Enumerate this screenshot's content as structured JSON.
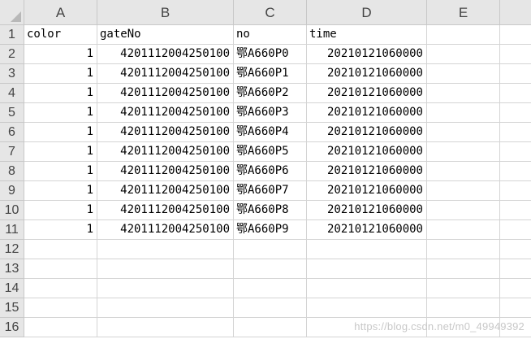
{
  "columns": [
    "A",
    "B",
    "C",
    "D",
    "E"
  ],
  "row_numbers": [
    "1",
    "2",
    "3",
    "4",
    "5",
    "6",
    "7",
    "8",
    "9",
    "10",
    "11",
    "12",
    "13",
    "14",
    "15",
    "16"
  ],
  "header": {
    "color": "color",
    "gateNo": "gateNo",
    "no": "no",
    "time": "time"
  },
  "rows": [
    {
      "color": "1",
      "gateNo": "4201112004250100",
      "no": "鄂A660P0",
      "time": "20210121060000"
    },
    {
      "color": "1",
      "gateNo": "4201112004250100",
      "no": "鄂A660P1",
      "time": "20210121060000"
    },
    {
      "color": "1",
      "gateNo": "4201112004250100",
      "no": "鄂A660P2",
      "time": "20210121060000"
    },
    {
      "color": "1",
      "gateNo": "4201112004250100",
      "no": "鄂A660P3",
      "time": "20210121060000"
    },
    {
      "color": "1",
      "gateNo": "4201112004250100",
      "no": "鄂A660P4",
      "time": "20210121060000"
    },
    {
      "color": "1",
      "gateNo": "4201112004250100",
      "no": "鄂A660P5",
      "time": "20210121060000"
    },
    {
      "color": "1",
      "gateNo": "4201112004250100",
      "no": "鄂A660P6",
      "time": "20210121060000"
    },
    {
      "color": "1",
      "gateNo": "4201112004250100",
      "no": "鄂A660P7",
      "time": "20210121060000"
    },
    {
      "color": "1",
      "gateNo": "4201112004250100",
      "no": "鄂A660P8",
      "time": "20210121060000"
    },
    {
      "color": "1",
      "gateNo": "4201112004250100",
      "no": "鄂A660P9",
      "time": "20210121060000"
    }
  ],
  "watermark": "https://blog.csdn.net/m0_49949392"
}
